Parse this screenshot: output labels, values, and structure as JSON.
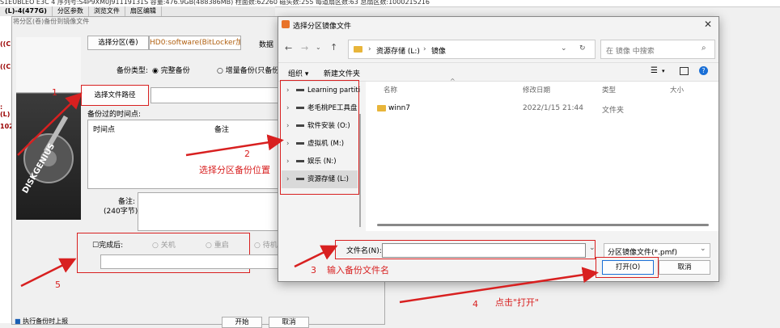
{
  "topbar": {
    "text": "S1EUBLEO E3C 4 序列号:S4P9XM0J91119131S 容量:476.9GB(488386MB) 柱面数:62260 磁头数:255 每道扇区数:63 总扇区数:1000215216",
    "tabs": [
      "(L)-4(477G)",
      "分区参数",
      "浏览文件",
      "扇区编辑"
    ]
  },
  "left_strip": [
    "((C",
    "((C",
    ":(L)",
    "102"
  ],
  "backup_dialog": {
    "title": "将分区(卷)备份到镜像文件",
    "select_partition_btn": "选择分区(卷)",
    "partition_value": "HD0:software(BitLocker加",
    "data_label": "数据",
    "backup_type_label": "备份类型:",
    "full_backup": "完整备份",
    "incremental": "增量备份(只备份",
    "select_path_btn": "选择文件路径",
    "history_label": "备份过的时间点:",
    "col_time": "时间点",
    "col_note": "备注",
    "note_label": "备注:",
    "note_limit": "(240字节)",
    "after_done": "完成后:",
    "opt_shutdown": "关机",
    "opt_restart": "重启",
    "opt_standby": "待机",
    "bottom_check": "执行备份时上报",
    "start_btn": "开始",
    "cancel_btn": "取消",
    "logo_text": "DISKGENIUS"
  },
  "file_dialog": {
    "title": "选择分区镜像文件",
    "breadcrumb": [
      "资源存储 (L:)",
      "镜像"
    ],
    "search_placeholder": "在 镜像 中搜索",
    "organize": "组织 ▾",
    "new_folder": "新建文件夹",
    "nav_items": [
      "Learning partiti",
      "老毛桃PE工具盘",
      "软件安装 (O:)",
      "虚拟机 (M:)",
      "娱乐 (N:)",
      "资源存储 (L:)"
    ],
    "col_name": "名称",
    "col_date": "修改日期",
    "col_type": "类型",
    "col_size": "大小",
    "files": [
      {
        "name": "winn7",
        "date": "2022/1/15 21:44",
        "type": "文件夹"
      }
    ],
    "filename_label": "文件名(N):",
    "filetype_value": "分区镜像文件(*.pmf)",
    "open_btn": "打开(O)",
    "cancel_btn": "取消"
  },
  "annotations": {
    "n1": "1",
    "n2": "2",
    "n2_text": "选择分区备份位置",
    "n3": "3",
    "n3_text": "输入备份文件名",
    "n4": "4",
    "n4_text": "点击\"打开\"",
    "n5": "5"
  },
  "colors": {
    "annotation_red": "#d82020",
    "folder": "#e8b53a",
    "selected_nav": "#d9d9d9"
  }
}
